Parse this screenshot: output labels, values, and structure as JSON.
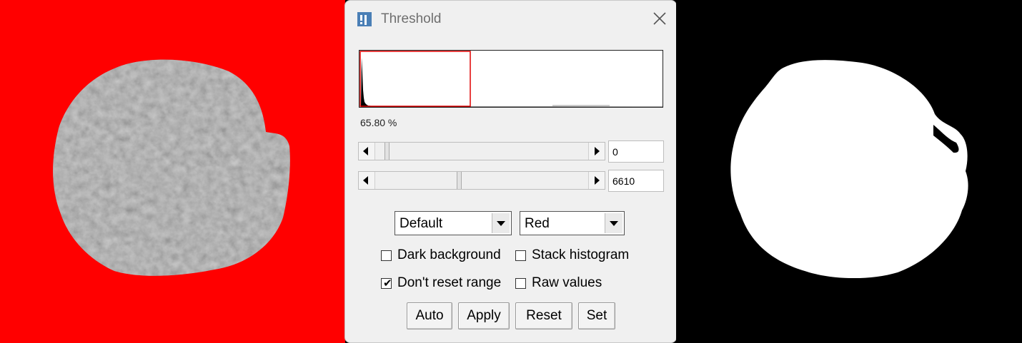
{
  "dialog": {
    "title": "Threshold",
    "percent_label": "65.80 %",
    "min_value": "0",
    "max_value": "6610",
    "method_select": {
      "selected": "Default"
    },
    "display_select": {
      "selected": "Red"
    },
    "checkboxes": [
      {
        "label": "Dark background",
        "checked": false
      },
      {
        "label": "Stack histogram",
        "checked": false
      },
      {
        "label": "Don't reset range",
        "checked": true
      },
      {
        "label": "Raw values",
        "checked": false
      }
    ],
    "buttons": {
      "auto": "Auto",
      "apply": "Apply",
      "reset": "Reset",
      "set": "Set"
    },
    "check_glyph": "✔"
  },
  "colors": {
    "threshold_overlay": "#ff0000",
    "mask_foreground": "#ffffff",
    "mask_background": "#000000",
    "dialog_bg": "#f0f0f0",
    "selection_line": "#e00000"
  },
  "icons": {
    "app": "imagej-icon",
    "close": "close-icon"
  }
}
